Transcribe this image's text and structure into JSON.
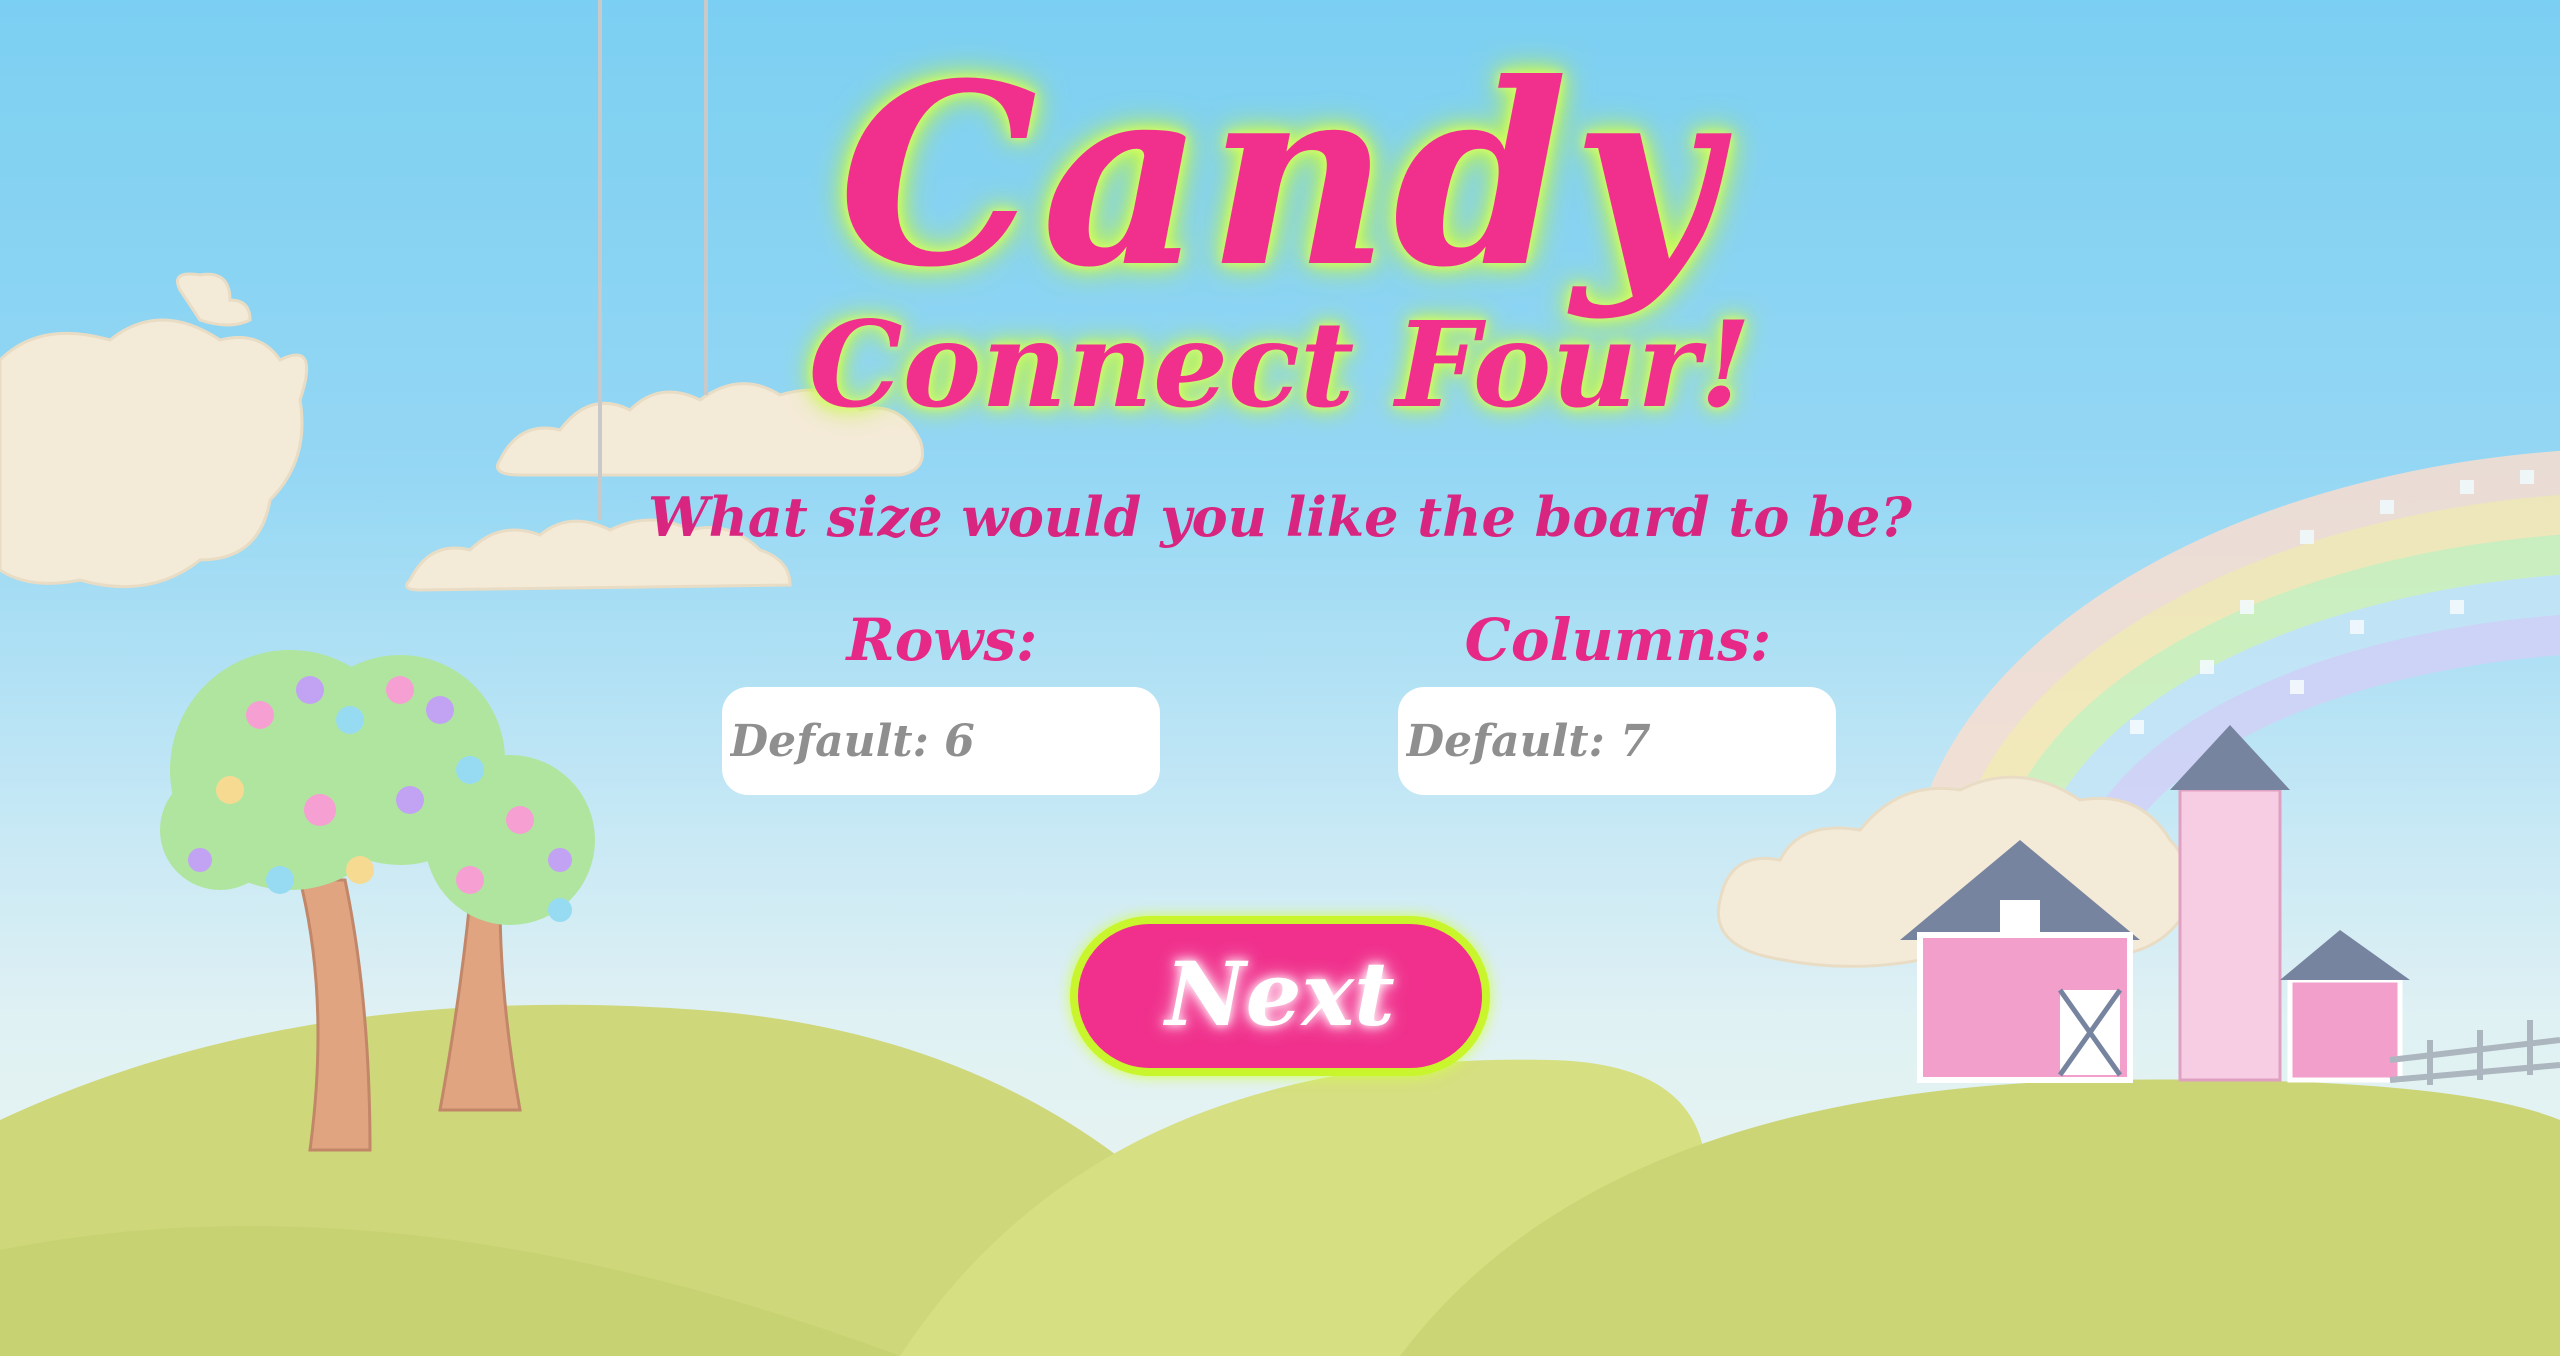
{
  "title": {
    "line1": "Candy",
    "line2": "Connect Four!"
  },
  "question": "What size would you like the board to be?",
  "rows": {
    "label": "Rows:",
    "placeholder": "Default: 6"
  },
  "columns": {
    "label": "Columns:",
    "placeholder": "Default: 7"
  },
  "next_button": {
    "label": "Next"
  },
  "colors": {
    "title_pink": "#f0308c",
    "glow_green": "#cfff4a",
    "sky_blue": "#5fc5ef",
    "hill_green": "#b9c84a"
  }
}
